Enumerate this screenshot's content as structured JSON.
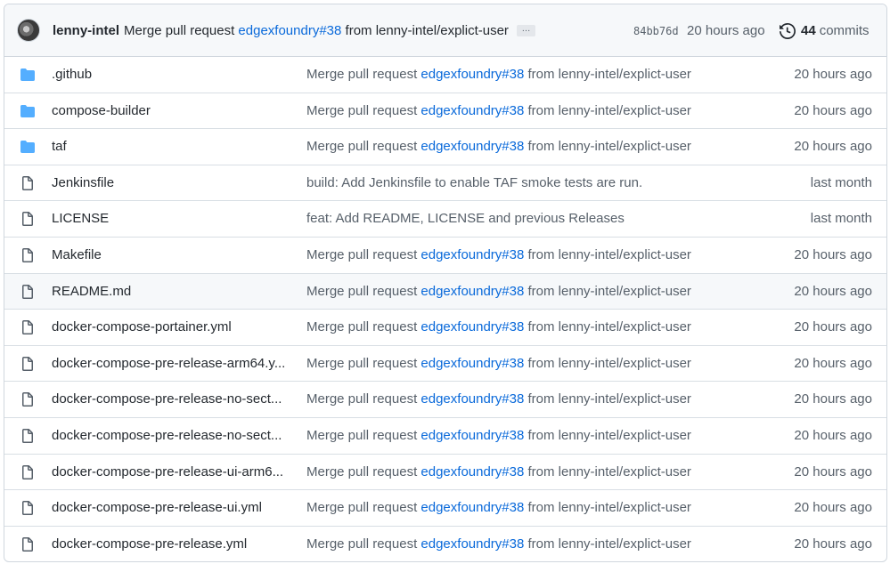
{
  "header": {
    "author": "lenny-intel",
    "message_prefix": "Merge pull request",
    "pr_link": "edgexfoundry#38",
    "message_suffix": "from lenny-intel/explict-user",
    "ellipsis": "…",
    "sha": "84bb76d",
    "time": "20 hours ago",
    "commit_count": "44",
    "commit_label": "commits"
  },
  "files": [
    {
      "name": ".github",
      "type": "folder",
      "msg": "Merge pull request ",
      "link": "edgexfoundry#38",
      "suffix": " from lenny-intel/explict-user",
      "time": "20 hours ago"
    },
    {
      "name": "compose-builder",
      "type": "folder",
      "msg": "Merge pull request ",
      "link": "edgexfoundry#38",
      "suffix": " from lenny-intel/explict-user",
      "time": "20 hours ago"
    },
    {
      "name": "taf",
      "type": "folder",
      "msg": "Merge pull request ",
      "link": "edgexfoundry#38",
      "suffix": " from lenny-intel/explict-user",
      "time": "20 hours ago"
    },
    {
      "name": "Jenkinsfile",
      "type": "file",
      "msg": "build: Add Jenkinsfile to enable TAF smoke tests are run.",
      "link": "",
      "suffix": "",
      "time": "last month"
    },
    {
      "name": "LICENSE",
      "type": "file",
      "msg": "feat: Add README, LICENSE and previous Releases",
      "link": "",
      "suffix": "",
      "time": "last month"
    },
    {
      "name": "Makefile",
      "type": "file",
      "msg": "Merge pull request ",
      "link": "edgexfoundry#38",
      "suffix": " from lenny-intel/explict-user",
      "time": "20 hours ago"
    },
    {
      "name": "README.md",
      "type": "file",
      "msg": "Merge pull request ",
      "link": "edgexfoundry#38",
      "suffix": " from lenny-intel/explict-user",
      "time": "20 hours ago"
    },
    {
      "name": "docker-compose-portainer.yml",
      "type": "file",
      "msg": "Merge pull request ",
      "link": "edgexfoundry#38",
      "suffix": " from lenny-intel/explict-user",
      "time": "20 hours ago"
    },
    {
      "name": "docker-compose-pre-release-arm64.y...",
      "type": "file",
      "msg": "Merge pull request ",
      "link": "edgexfoundry#38",
      "suffix": " from lenny-intel/explict-user",
      "time": "20 hours ago"
    },
    {
      "name": "docker-compose-pre-release-no-sect...",
      "type": "file",
      "msg": "Merge pull request ",
      "link": "edgexfoundry#38",
      "suffix": " from lenny-intel/explict-user",
      "time": "20 hours ago"
    },
    {
      "name": "docker-compose-pre-release-no-sect...",
      "type": "file",
      "msg": "Merge pull request ",
      "link": "edgexfoundry#38",
      "suffix": " from lenny-intel/explict-user",
      "time": "20 hours ago"
    },
    {
      "name": "docker-compose-pre-release-ui-arm6...",
      "type": "file",
      "msg": "Merge pull request ",
      "link": "edgexfoundry#38",
      "suffix": " from lenny-intel/explict-user",
      "time": "20 hours ago"
    },
    {
      "name": "docker-compose-pre-release-ui.yml",
      "type": "file",
      "msg": "Merge pull request ",
      "link": "edgexfoundry#38",
      "suffix": " from lenny-intel/explict-user",
      "time": "20 hours ago"
    },
    {
      "name": "docker-compose-pre-release.yml",
      "type": "file",
      "msg": "Merge pull request ",
      "link": "edgexfoundry#38",
      "suffix": " from lenny-intel/explict-user",
      "time": "20 hours ago"
    }
  ],
  "colors": {
    "accent": "#0969da",
    "folder": "#54aeff",
    "muted": "#57606a"
  }
}
